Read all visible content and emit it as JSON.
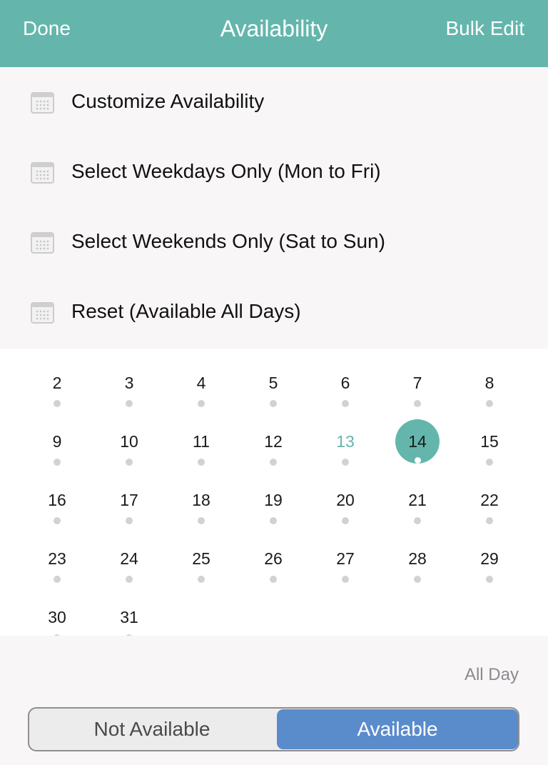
{
  "navbar": {
    "left_label": "Done",
    "title": "Availability",
    "right_label": "Bulk Edit",
    "color": "#64b6ac"
  },
  "options": [
    {
      "icon": "calendar-icon",
      "label": "Customize Availability"
    },
    {
      "icon": "calendar-icon",
      "label": "Select Weekdays Only (Mon to Fri)"
    },
    {
      "icon": "calendar-icon",
      "label": "Select Weekends Only (Sat to Sun)"
    },
    {
      "icon": "calendar-icon",
      "label": "Reset (Available All Days)"
    }
  ],
  "calendar": {
    "weeks": [
      [
        "2",
        "3",
        "4",
        "5",
        "6",
        "7",
        "8"
      ],
      [
        "9",
        "10",
        "11",
        "12",
        "13",
        "14",
        "15"
      ],
      [
        "16",
        "17",
        "18",
        "19",
        "20",
        "21",
        "22"
      ],
      [
        "23",
        "24",
        "25",
        "26",
        "27",
        "28",
        "29"
      ],
      [
        "30",
        "31"
      ]
    ],
    "today": "13",
    "selected": "14",
    "accent_color": "#64b6ac"
  },
  "footer": {
    "all_day_label": "All Day",
    "segments": [
      "Not Available",
      "Available"
    ],
    "selected_segment": "Available",
    "selected_color": "#5a8ccc"
  }
}
